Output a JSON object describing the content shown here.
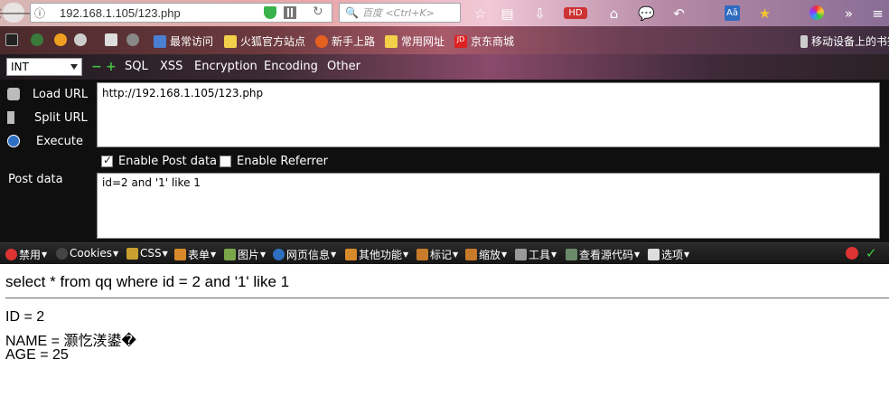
{
  "browser": {
    "url": "192.168.1.105/123.php",
    "search_placeholder": "百度 <Ctrl+K>"
  },
  "bookmarks": {
    "items": [
      "最常访问",
      "火狐官方站点",
      "新手上路",
      "常用网址",
      "京东商城"
    ],
    "mobile": "移动设备上的书签"
  },
  "hackbar": {
    "select_value": "INT",
    "menus": [
      "SQL",
      "XSS",
      "Encryption",
      "Encoding",
      "Other"
    ],
    "load_url": "Load URL",
    "split_url": "Split URL",
    "execute": "Execute",
    "url_value": "http://192.168.1.105/123.php",
    "enable_post": "Enable Post data",
    "enable_referrer": "Enable Referrer",
    "post_label": "Post data",
    "post_value": "id=2 and '1' like 1"
  },
  "webdev": {
    "items": [
      "禁用",
      "Cookies",
      "CSS",
      "表单",
      "图片",
      "网页信息",
      "其他功能",
      "标记",
      "缩放",
      "工具",
      "查看源代码",
      "选项"
    ]
  },
  "page": {
    "sql": "select * from qq where id = 2 and '1' like 1",
    "id": "ID = 2",
    "name": "NAME = 灏忔湵鍙�",
    "age": "AGE = 25"
  }
}
